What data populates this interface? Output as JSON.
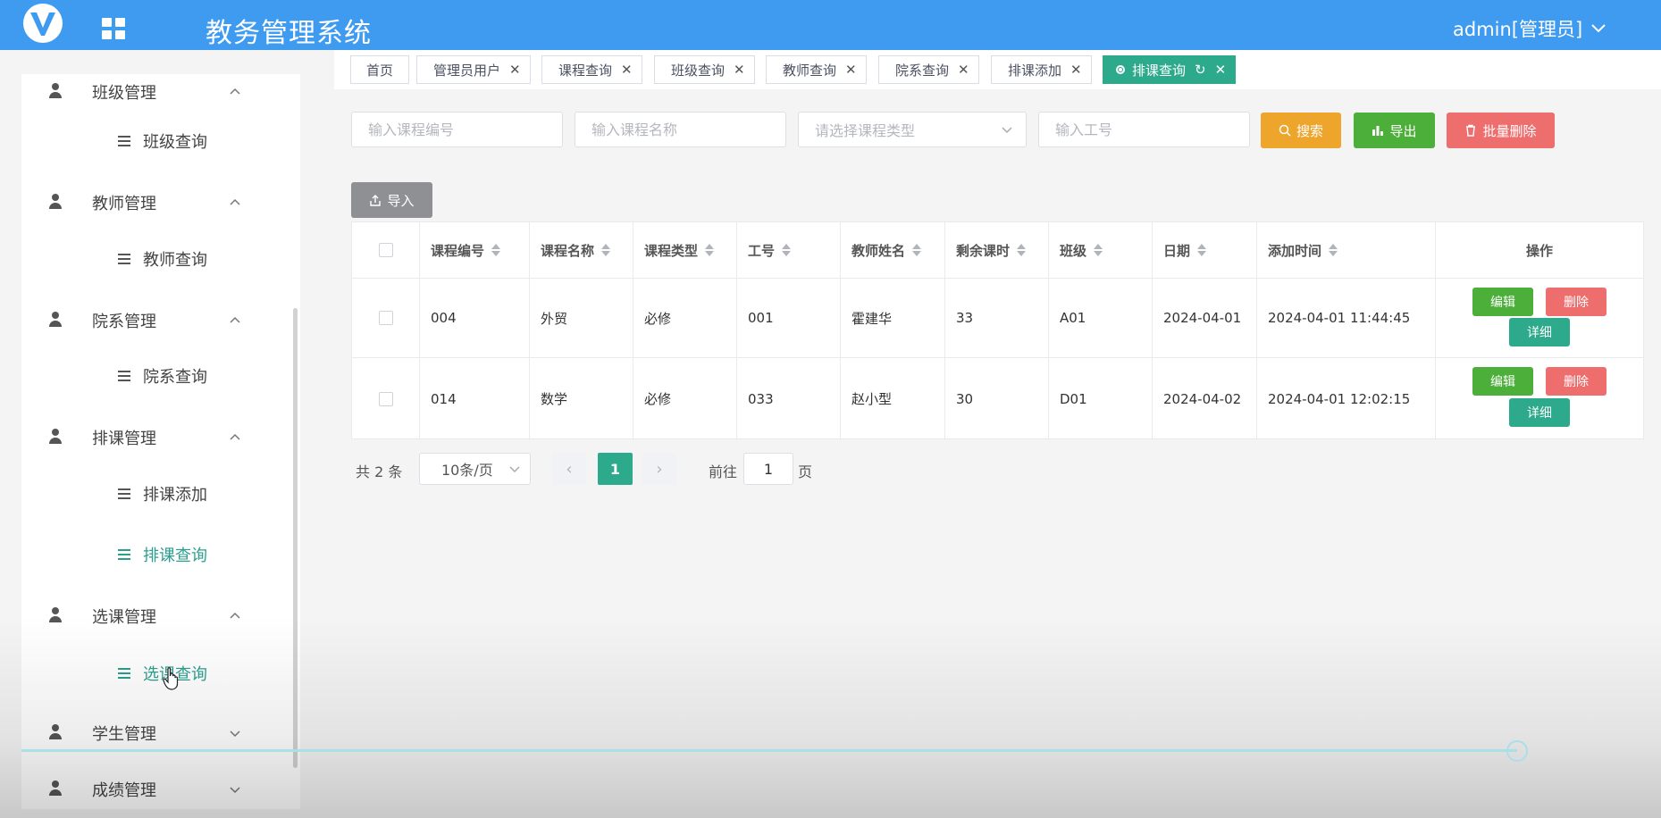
{
  "header": {
    "title": "教务管理系统",
    "user": "admin[管理员]",
    "bg_color": "#3f9bef"
  },
  "sidebar": {
    "items": [
      {
        "type": "group",
        "label": "班级管理",
        "expanded": true
      },
      {
        "type": "sub",
        "label": "班级查询"
      },
      {
        "type": "group",
        "label": "教师管理",
        "expanded": true
      },
      {
        "type": "sub",
        "label": "教师查询"
      },
      {
        "type": "group",
        "label": "院系管理",
        "expanded": true
      },
      {
        "type": "sub",
        "label": "院系查询"
      },
      {
        "type": "group",
        "label": "排课管理",
        "expanded": true
      },
      {
        "type": "sub",
        "label": "排课添加"
      },
      {
        "type": "sub",
        "label": "排课查询",
        "active": true
      },
      {
        "type": "group",
        "label": "选课管理",
        "expanded": true
      },
      {
        "type": "sub",
        "label": "选课查询",
        "hover": true
      },
      {
        "type": "group",
        "label": "学生管理",
        "expanded": false
      },
      {
        "type": "group",
        "label": "成绩管理",
        "expanded": false
      }
    ],
    "active_color": "#2b9e8e"
  },
  "tabs": [
    {
      "label": "首页",
      "closable": false
    },
    {
      "label": "管理员用户",
      "closable": true
    },
    {
      "label": "课程查询",
      "closable": true
    },
    {
      "label": "班级查询",
      "closable": true
    },
    {
      "label": "教师查询",
      "closable": true
    },
    {
      "label": "院系查询",
      "closable": true
    },
    {
      "label": "排课添加",
      "closable": true
    },
    {
      "label": "排课查询",
      "closable": true,
      "active": true
    }
  ],
  "filters": {
    "course_code_placeholder": "输入课程编号",
    "course_name_placeholder": "输入课程名称",
    "course_type_placeholder": "请选择课程类型",
    "staff_no_placeholder": "输入工号"
  },
  "buttons": {
    "search": "搜索",
    "export": "导出",
    "batch_delete": "批量删除",
    "import": "导入"
  },
  "table": {
    "columns": [
      "课程编号",
      "课程名称",
      "课程类型",
      "工号",
      "教师姓名",
      "剩余课时",
      "班级",
      "日期",
      "添加时间",
      "操作"
    ],
    "rows": [
      {
        "course_code": "004",
        "course_name": "外贸",
        "course_type": "必修",
        "staff_no": "001",
        "teacher": "霍建华",
        "remaining_hours": "33",
        "class": "A01",
        "date": "2024-04-01",
        "added": "2024-04-01 11:44:45"
      },
      {
        "course_code": "014",
        "course_name": "数学",
        "course_type": "必修",
        "staff_no": "033",
        "teacher": "赵小型",
        "remaining_hours": "30",
        "class": "D01",
        "date": "2024-04-02",
        "added": "2024-04-01 12:02:15"
      }
    ],
    "row_actions": {
      "edit": "编辑",
      "delete": "删除",
      "detail": "详细"
    }
  },
  "pagination": {
    "total": "共 2 条",
    "page_size": "10条/页",
    "current_page": "1",
    "goto_label": "前往",
    "goto_value": "1",
    "page_unit": "页"
  },
  "colors": {
    "primary": "#2daa8c",
    "warning": "#eda52c",
    "success": "#4caf3a",
    "danger": "#ee6e6e"
  },
  "video": {
    "progress": 0.93
  }
}
